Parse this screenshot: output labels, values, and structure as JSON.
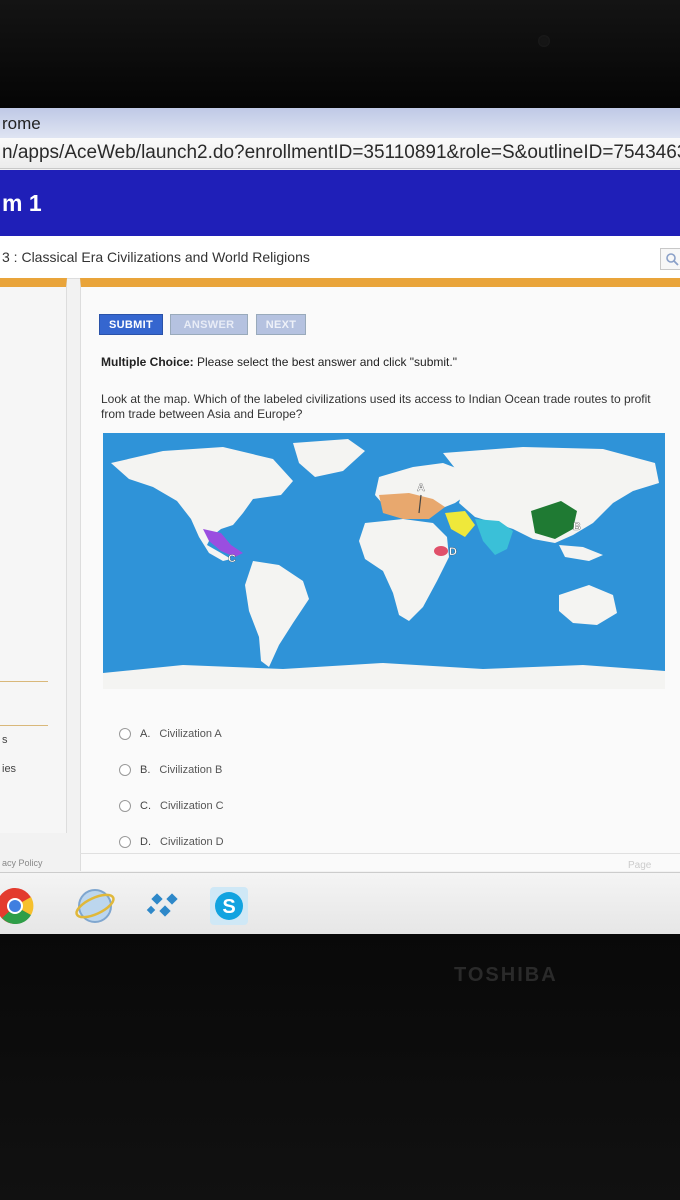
{
  "browser": {
    "title": "rome",
    "url": "n/apps/AceWeb/launch2.do?enrollmentID=35110891&role=S&outlineID=7543463378"
  },
  "banner": {
    "title": "m 1"
  },
  "lesson": {
    "title": "3 : Classical Era Civilizations and World Religions"
  },
  "toolbar": {
    "submit_label": "SUBMIT",
    "answer_label": "ANSWER",
    "next_label": "NEXT"
  },
  "instructions": {
    "label": "Multiple Choice:",
    "text": " Please select the best answer and click \"submit.\""
  },
  "question": {
    "text": "Look at the map. Which of the labeled civilizations used its access to Indian Ocean trade routes to profit from trade between Asia and Europe?"
  },
  "map": {
    "labels": [
      "A",
      "B",
      "C",
      "D"
    ],
    "colors": {
      "ocean": "#2f93d8",
      "land": "#f4f4f2",
      "civ_a": "#e8a86e",
      "civ_b": "#1f7a33",
      "civ_c": "#9a4ee0",
      "civ_d": "#e0506a",
      "yellow": "#efe83a",
      "teal": "#3ac0d8"
    }
  },
  "choices": [
    {
      "letter": "A.",
      "text": "Civilization A"
    },
    {
      "letter": "B.",
      "text": "Civilization B"
    },
    {
      "letter": "C.",
      "text": "Civilization C"
    },
    {
      "letter": "D.",
      "text": "Civilization D"
    }
  ],
  "sidebar": {
    "item1": "s",
    "item2": "ies",
    "privacy": "acy Policy"
  },
  "footer": {
    "page_label": "Page"
  },
  "device": {
    "brand": "TOSHIBA"
  },
  "taskbar": {
    "icons": [
      "chrome-icon",
      "internet-explorer-icon",
      "kodi-icon",
      "skype-icon"
    ]
  }
}
